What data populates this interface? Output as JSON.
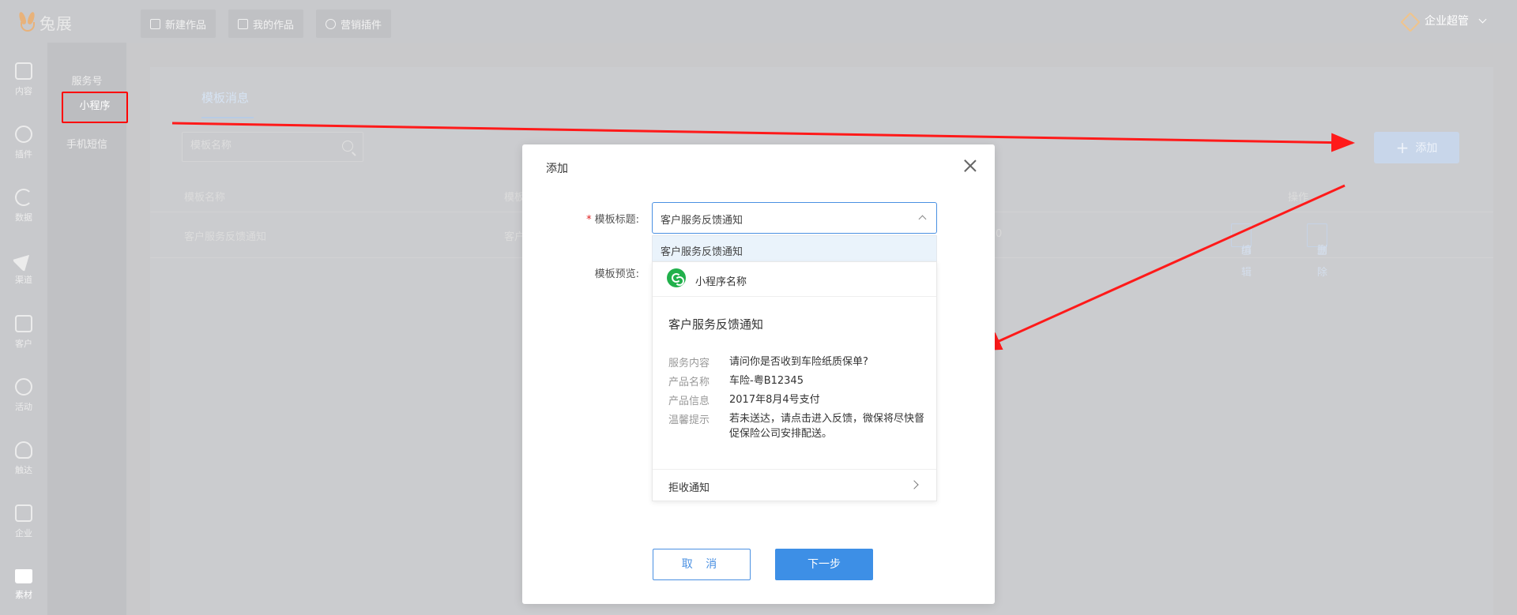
{
  "app": {
    "logo_text": "兔展"
  },
  "top_nav": [
    {
      "label": "新建作品",
      "icon": "plus-square-icon"
    },
    {
      "label": "我的作品",
      "icon": "image-icon"
    },
    {
      "label": "营销插件",
      "icon": "plugin-icon"
    }
  ],
  "user": {
    "name": "企业超管",
    "icon": "diamond-icon"
  },
  "rail": [
    {
      "label": "内容",
      "icon": "document-icon"
    },
    {
      "label": "插件",
      "icon": "cube-icon"
    },
    {
      "label": "数据",
      "icon": "pie-chart-icon"
    },
    {
      "label": "渠道",
      "icon": "send-icon"
    },
    {
      "label": "客户",
      "icon": "contacts-icon"
    },
    {
      "label": "活动",
      "icon": "activity-icon"
    },
    {
      "label": "触达",
      "icon": "person-icon"
    },
    {
      "label": "企业",
      "icon": "building-icon"
    },
    {
      "label": "素材",
      "icon": "folder-icon"
    }
  ],
  "subnav": [
    {
      "label": "服务号"
    },
    {
      "label": "小程序"
    },
    {
      "label": "手机短信"
    }
  ],
  "main": {
    "tab": "模板消息",
    "search_placeholder": "模板名称",
    "add_button": "添加",
    "columns": {
      "name": "模板名称",
      "title": "模板",
      "op": "操作"
    },
    "row": {
      "name": "客户服务反馈通知",
      "title": "客户",
      "time": "0",
      "edit": "编辑",
      "delete": "删除"
    }
  },
  "modal": {
    "title": "添加",
    "title_label": "模板标题:",
    "preview_label": "模板预览:",
    "selected": "客户服务反馈通知",
    "option": "客户服务反馈通知",
    "preview": {
      "app_name": "小程序名称",
      "heading": "客户服务反馈通知",
      "rows": [
        {
          "k": "服务内容",
          "v": "请问你是否收到车险纸质保单?"
        },
        {
          "k": "产品名称",
          "v": "车险-粤B12345"
        },
        {
          "k": "产品信息",
          "v": "2017年8月4号支付"
        },
        {
          "k": "温馨提示",
          "v": "若未送达，请点击进入反馈，微保将尽快督促保险公司安排配送。"
        }
      ],
      "footer": "拒收通知"
    },
    "cancel": "取 消",
    "next": "下一步"
  },
  "colors": {
    "primary": "#3d8fe6",
    "annotation": "#ff0000",
    "mini_program": "#21b04b"
  }
}
